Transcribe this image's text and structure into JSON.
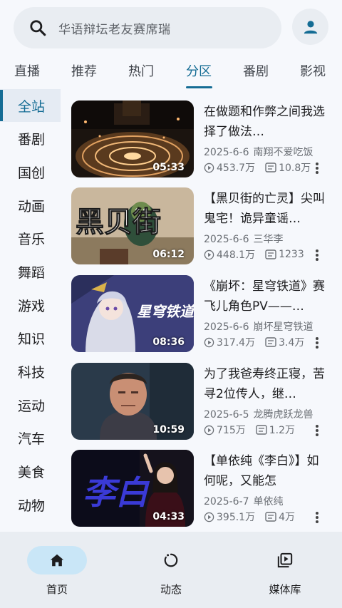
{
  "search": {
    "placeholder": "华语辩坛老友赛席瑞",
    "icon": "search-icon"
  },
  "profile": {
    "icon": "account-icon"
  },
  "tabs": [
    {
      "label": "直播"
    },
    {
      "label": "推荐"
    },
    {
      "label": "热门"
    },
    {
      "label": "分区",
      "active": true
    },
    {
      "label": "番剧"
    },
    {
      "label": "影视"
    }
  ],
  "categories": [
    {
      "label": "全站",
      "active": true
    },
    {
      "label": "番剧"
    },
    {
      "label": "国创"
    },
    {
      "label": "动画"
    },
    {
      "label": "音乐"
    },
    {
      "label": "舞蹈"
    },
    {
      "label": "游戏"
    },
    {
      "label": "知识"
    },
    {
      "label": "科技"
    },
    {
      "label": "运动"
    },
    {
      "label": "汽车"
    },
    {
      "label": "美食"
    },
    {
      "label": "动物"
    }
  ],
  "videos": [
    {
      "title": "在做题和作弊之间我选择了做法…",
      "date": "2025-6-6",
      "uploader": "南翔不爱吃饭",
      "views": "453.7万",
      "danmaku": "10.8万",
      "duration": "05:33"
    },
    {
      "title": "【黑贝街的亡灵】尖叫鬼宅！诡异童谣…",
      "date": "2025-6-6",
      "uploader": "三华李",
      "views": "448.1万",
      "danmaku": "1233",
      "duration": "06:12",
      "thumb_text": "黑贝街"
    },
    {
      "title": "《崩坏：星穹铁道》赛飞儿角色PV——…",
      "date": "2025-6-6",
      "uploader": "崩坏星穹铁道",
      "views": "317.4万",
      "danmaku": "3.4万",
      "duration": "08:36",
      "thumb_text": "星穹铁道"
    },
    {
      "title": "为了我爸寿终正寝，苦寻2位传人，继…",
      "date": "2025-6-5",
      "uploader": "龙腾虎跃龙兽",
      "views": "715万",
      "danmaku": "1.2万",
      "duration": "10:59"
    },
    {
      "title": "【单依纯《李白》】如何呢，又能怎",
      "date": "2025-6-7",
      "uploader": "单依纯",
      "views": "395.1万",
      "danmaku": "4万",
      "duration": "04:33",
      "thumb_text": "李白"
    }
  ],
  "bottom_nav": [
    {
      "label": "首页",
      "icon": "home-icon",
      "active": true
    },
    {
      "label": "动态",
      "icon": "activity-icon"
    },
    {
      "label": "媒体库",
      "icon": "media-library-icon"
    }
  ],
  "colors": {
    "accent": "#146c94",
    "nav_active_pill": "#c9e6f7",
    "background": "#f6f8fc",
    "surface": "#e9edf2"
  }
}
